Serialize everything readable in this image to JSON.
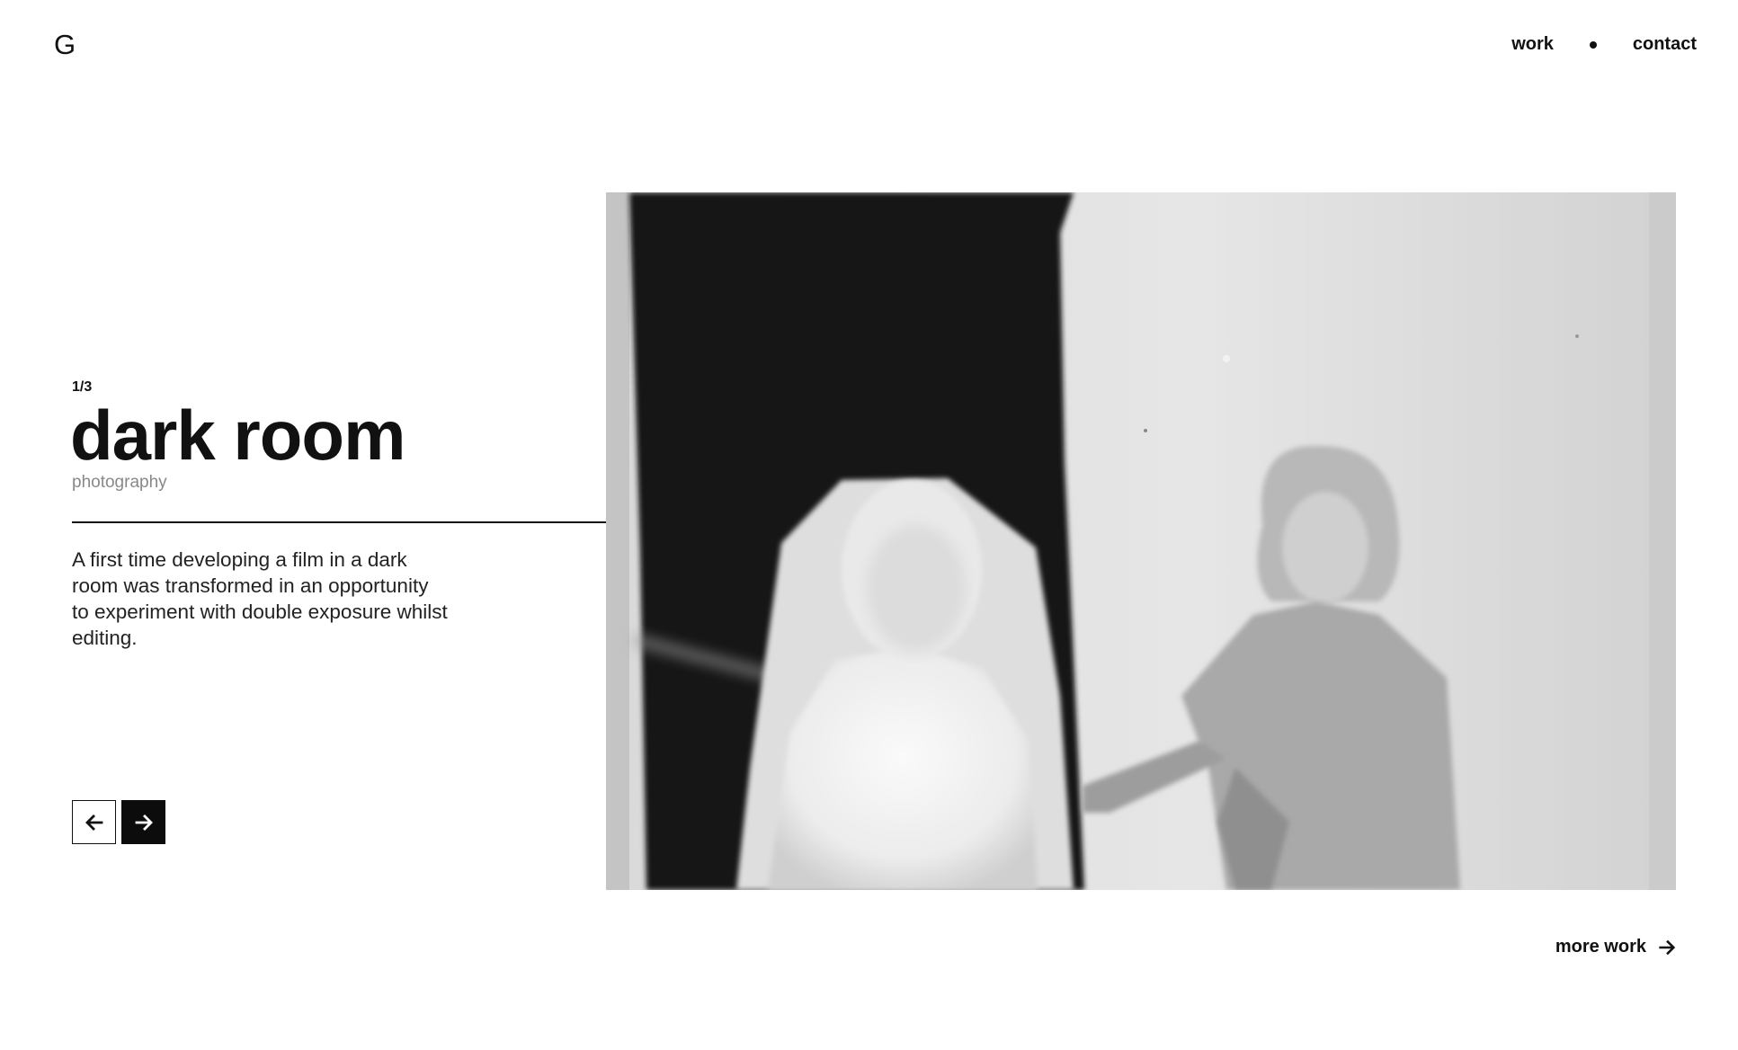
{
  "header": {
    "logo": "G",
    "nav": {
      "work": "work",
      "contact": "contact"
    }
  },
  "project": {
    "counter": "1/3",
    "title": "dark room",
    "category": "photography",
    "description": "A first time developing a film in a dark room was transformed in an opportunity to experiment with double exposure whilst editing."
  },
  "controls": {
    "prev_icon": "arrow-left-icon",
    "next_icon": "arrow-right-icon"
  },
  "footer": {
    "more_label": "more work",
    "more_icon": "arrow-right-icon"
  },
  "colors": {
    "text": "#111111",
    "muted": "#888888",
    "background": "#ffffff",
    "button_dark": "#0c0c0c"
  }
}
